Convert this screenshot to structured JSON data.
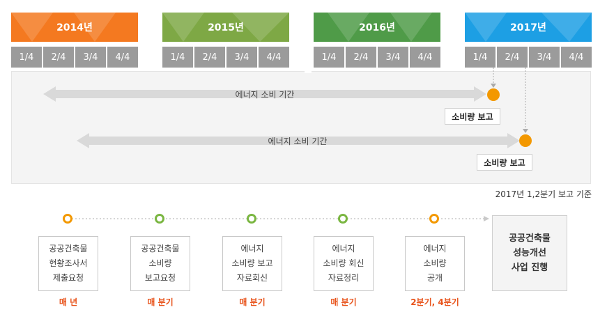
{
  "years": [
    {
      "label": "2014년",
      "color": "#f47920"
    },
    {
      "label": "2015년",
      "color": "#7ea845"
    },
    {
      "label": "2016년",
      "color": "#4f9b48"
    },
    {
      "label": "2017년",
      "color": "#1d9fe4"
    }
  ],
  "quarters": [
    "1/4",
    "2/4",
    "3/4",
    "4/4"
  ],
  "timeline": {
    "arrow1_label": "에너지 소비 기간",
    "arrow2_label": "에너지 소비 기간",
    "report1_label": "소비량 보고",
    "report2_label": "소비량 보고",
    "basis_note": "2017년 1,2분기 보고 기준"
  },
  "process": {
    "steps": [
      {
        "line1": "공공건축물",
        "line2": "현황조사서",
        "line3": "제출요청",
        "freq": "매 년",
        "circle_color": "#f39800"
      },
      {
        "line1": "공공건축물",
        "line2": "소비량",
        "line3": "보고요청",
        "freq": "매 분기",
        "circle_color": "#7ab641"
      },
      {
        "line1": "에너지",
        "line2": "소비량 보고",
        "line3": "자료회신",
        "freq": "매 분기",
        "circle_color": "#7ab641"
      },
      {
        "line1": "에너지",
        "line2": "소비량 회신",
        "line3": "자료정리",
        "freq": "매 분기",
        "circle_color": "#7ab641"
      },
      {
        "line1": "에너지",
        "line2": "소비량",
        "line3": "공개",
        "freq": "2분기, 4분기",
        "circle_color": "#f39800"
      }
    ],
    "final": {
      "line1": "공공건축물",
      "line2": "성능개선",
      "line3": "사업 진행"
    }
  }
}
